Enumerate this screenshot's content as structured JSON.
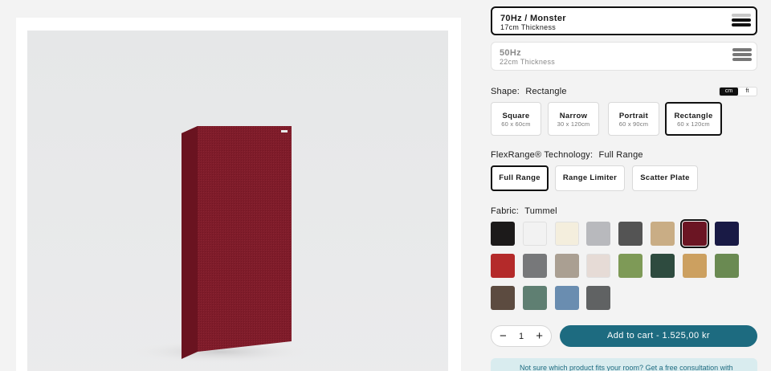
{
  "thickness": {
    "options": [
      {
        "name": "70Hz / Monster",
        "sub": "17cm Thickness"
      },
      {
        "name": "50Hz",
        "sub": "22cm Thickness"
      }
    ]
  },
  "shape": {
    "label": "Shape:",
    "value": "Rectangle",
    "units": [
      "cm",
      "ft"
    ],
    "options": [
      {
        "name": "Square",
        "size": "60 x 60cm"
      },
      {
        "name": "Narrow",
        "size": "30 x 120cm"
      },
      {
        "name": "Portrait",
        "size": "60 x 90cm"
      },
      {
        "name": "Rectangle",
        "size": "60 x 120cm"
      }
    ]
  },
  "flexrange": {
    "label": "FlexRange® Technology:",
    "value": "Full Range",
    "options": [
      "Full Range",
      "Range Limiter",
      "Scatter Plate"
    ]
  },
  "fabric": {
    "label": "Fabric:",
    "value": "Tummel",
    "selected_index": 6,
    "colors": [
      "#1c1a1a",
      "#f2f2f2",
      "#f4eedd",
      "#b8b9bd",
      "#545454",
      "#c9ad85",
      "#6b1523",
      "#191a45",
      "#b42a2a",
      "#77787a",
      "#aa9f92",
      "#e6dbd6",
      "#7e9a57",
      "#2e4b3f",
      "#cca060",
      "#6a8a52",
      "#5c4b40",
      "#5f7f72",
      "#6a8db0",
      "#606263"
    ]
  },
  "cart": {
    "quantity": "1",
    "minus": "−",
    "plus": "+",
    "button_label": "Add to cart  -  1.525,00 kr"
  },
  "help_text": "Not sure which product fits your room? Get a free consultation with",
  "accent_color": "#1d6b80"
}
